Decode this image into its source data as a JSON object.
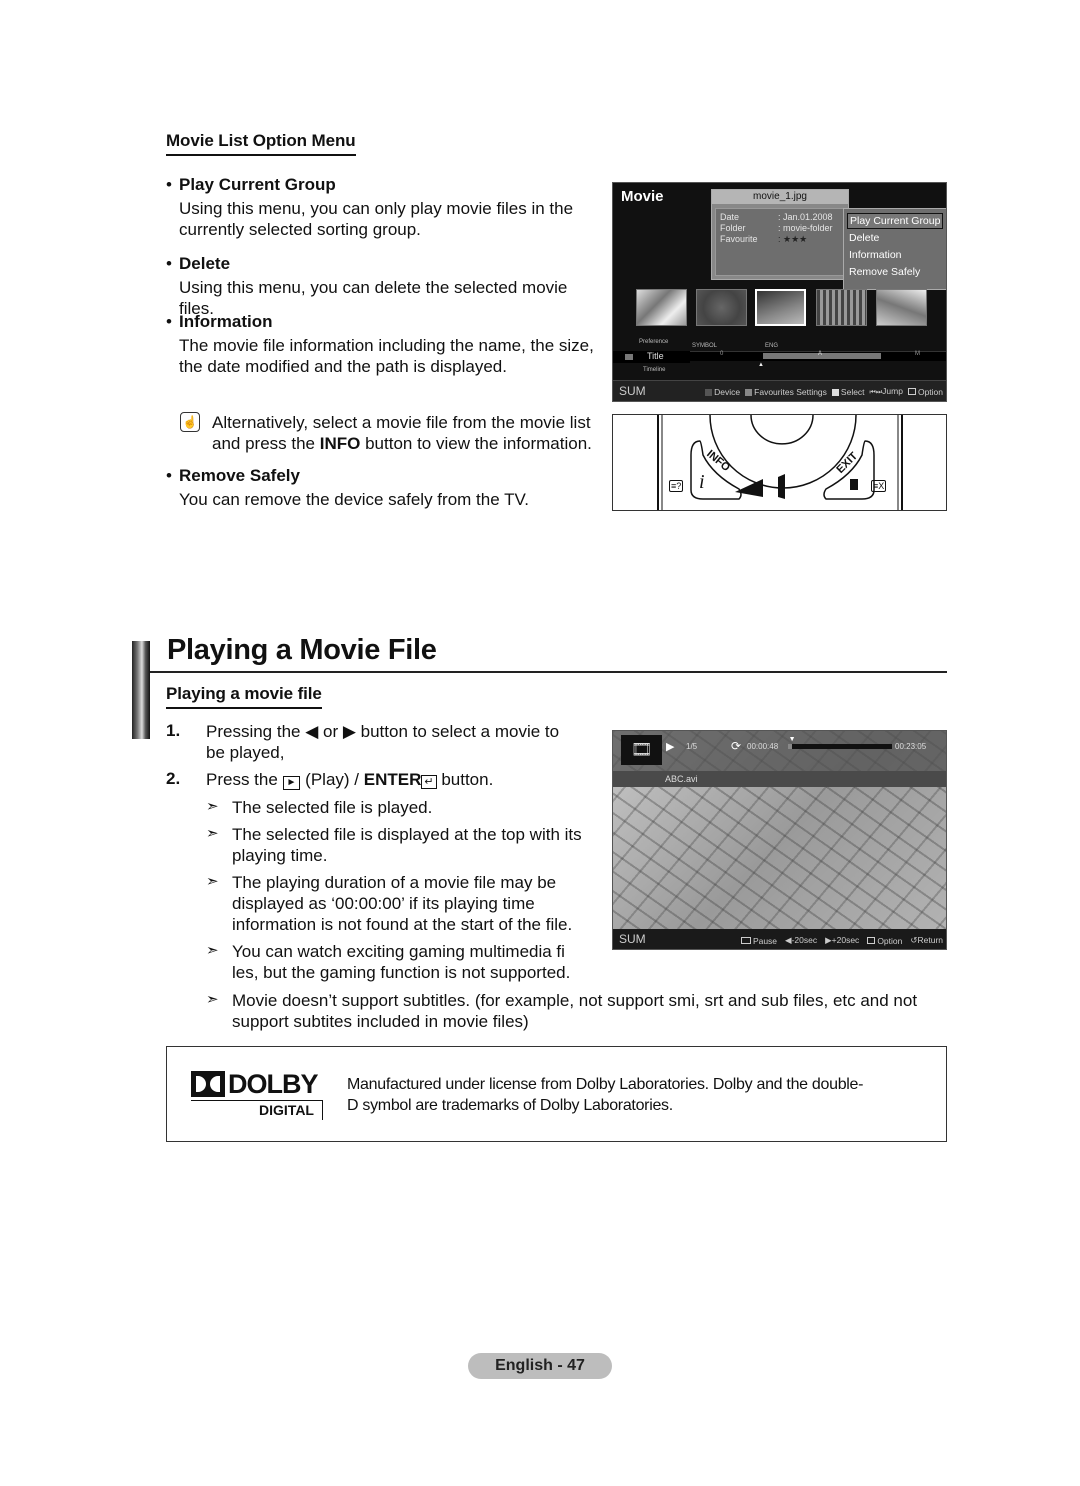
{
  "option_menu_section": {
    "heading": "Movie List Option Menu",
    "items": [
      {
        "title": "Play Current Group",
        "desc_lines": [
          "Using this menu, you can only play movie files in the",
          "currently selected sorting group."
        ]
      },
      {
        "title": "Delete",
        "desc_lines": [
          "Using this menu, you can delete the selected movie files."
        ]
      },
      {
        "title": "Information",
        "desc_lines": [
          "The movie file information including the name, the size,",
          "the date modified and the path is displayed."
        ]
      }
    ],
    "note": {
      "icon": "note-hand-icon",
      "line1": "Alternatively, select a movie file from the movie list",
      "line2_pre": "and press the ",
      "line2_bold": "INFO",
      "line2_post": " button to view the information."
    },
    "remove": {
      "title": "Remove Safely",
      "desc": "You can remove the device safely from the TV."
    },
    "bullet": "•"
  },
  "tv_screen_1": {
    "title": "Movie",
    "popup": {
      "filename": "movie_1.jpg",
      "rows": [
        {
          "key": "Date",
          "value": ": Jan.01.2008"
        },
        {
          "key": "Folder",
          "value": ": movie-folder"
        },
        {
          "key": "Favourite",
          "value": ": ★★★"
        }
      ]
    },
    "option_menu": {
      "items": [
        "Play Current Group",
        "Delete",
        "Information",
        "Remove Safely"
      ],
      "selected_index": 0
    },
    "thumbnails_count": 5,
    "selected_thumbnail": 3,
    "sort": {
      "above": "Preference",
      "current": "Title",
      "below": "Timeline",
      "groups": [
        "SYMBOL",
        "ENG"
      ],
      "scale": [
        "0",
        "A",
        "M"
      ]
    },
    "footer": {
      "left": "SUM",
      "items": [
        {
          "label": "Device",
          "color": "#555555"
        },
        {
          "label": "Favourites Settings",
          "color": "#888888"
        },
        {
          "label": "Select",
          "color": "#dddddd"
        },
        {
          "label": "Jump",
          "icon": "skip-icon"
        },
        {
          "label": "Option",
          "icon": "option-icon"
        }
      ]
    }
  },
  "remote": {
    "info_label": "INFO",
    "info_glyph": "i",
    "exit_label": "EXIT",
    "left_small": "≡?",
    "right_small": "≡X"
  },
  "playing_section": {
    "title": "Playing a Movie File",
    "subheading": "Playing a movie file",
    "steps": [
      {
        "num": "1.",
        "lines": [
          "Pressing the ◀ or ▶ button to select a movie to",
          "be played,"
        ]
      },
      {
        "num": "2.",
        "pre": "Press the ",
        "play_symbol": "►",
        "mid": " (Play) / ",
        "bold": "ENTER",
        "enter_symbol": "↵",
        "post": " button."
      }
    ],
    "notes": [
      {
        "lines": [
          "The selected file is played."
        ]
      },
      {
        "lines": [
          "The selected file is displayed at the top with its",
          "playing time."
        ]
      },
      {
        "lines": [
          "The playing duration of a movie file may be",
          "displayed as ‘00:00:00’ if its playing time",
          "information is not found at the start of the file."
        ]
      },
      {
        "lines": [
          "You can watch exciting gaming multimedia fi",
          "les, but the gaming function is not supported."
        ]
      },
      {
        "lines": [
          "Movie doesn’t support subtitles. (for example, not support smi, srt and sub files, etc and not",
          "support subtites included in movie files)"
        ]
      }
    ],
    "arrow": "➣"
  },
  "tv_screen_2": {
    "play_icon": "▶",
    "counter": "1/5",
    "elapsed": "00:00:48",
    "total": "00:23:05",
    "progress_fraction": 0.035,
    "filename": "ABC.avi",
    "footer": {
      "left": "SUM",
      "items": [
        {
          "label": "Pause",
          "icon": "enter-icon"
        },
        {
          "label": "-20sec",
          "icon": "◀"
        },
        {
          "label": "+20sec",
          "icon": "▶"
        },
        {
          "label": "Option",
          "icon": "option-icon"
        },
        {
          "label": "Return",
          "icon": "return-icon"
        }
      ]
    }
  },
  "dolby": {
    "logo_text": "DOLBY",
    "logo_sub": "DIGITAL",
    "line1": "Manufactured under license from Dolby Laboratories. Dolby and the double-",
    "line2": "D symbol are trademarks of Dolby Laboratories."
  },
  "footer": {
    "page_label": "English - 47"
  }
}
